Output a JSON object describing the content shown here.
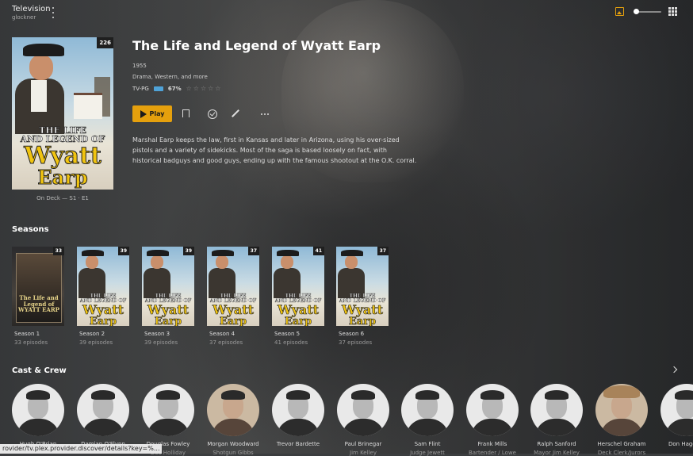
{
  "topbar": {
    "title": "Television",
    "subtitle": "glockner"
  },
  "show": {
    "title": "The Life and Legend of Wyatt Earp",
    "year": "1955",
    "genres": "Drama, Western, and more",
    "content_rating": "TV-PG",
    "audience_score": "67%",
    "summary": "Marshal Earp keeps the law, first in Kansas and later in Arizona, using his over-sized pistols and a variety of sidekicks. Most of the saga is based loosely on fact, with historical badguys and good guys, ending up with the famous shootout at the O.K. corral.",
    "episode_count_badge": "226",
    "on_deck": "On Deck — S1 · E1",
    "poster_text": [
      "THE LIFE",
      "AND LEGEND OF",
      "Wyatt",
      "Earp"
    ]
  },
  "actions": {
    "play_label": "Play"
  },
  "seasons_section": {
    "title": "Seasons"
  },
  "seasons": [
    {
      "name": "Season 1",
      "episodes": "33 episodes",
      "badge": "33",
      "dark": true,
      "poster_text": [
        "The Life and Legend of",
        "WYATT EARP"
      ]
    },
    {
      "name": "Season 2",
      "episodes": "39 episodes",
      "badge": "39",
      "dark": false
    },
    {
      "name": "Season 3",
      "episodes": "39 episodes",
      "badge": "39",
      "dark": false
    },
    {
      "name": "Season 4",
      "episodes": "37 episodes",
      "badge": "37",
      "dark": false
    },
    {
      "name": "Season 5",
      "episodes": "41 episodes",
      "badge": "41",
      "dark": false
    },
    {
      "name": "Season 6",
      "episodes": "37 episodes",
      "badge": "37",
      "dark": false
    }
  ],
  "season_poster_text": [
    "THE LIFE",
    "AND LEGEND OF",
    "Wyatt",
    "Earp"
  ],
  "cast_section": {
    "title": "Cast & Crew"
  },
  "cast": [
    {
      "name": "Hugh O'Brian",
      "role": ""
    },
    {
      "name": "Damian O'Flynn",
      "role": ""
    },
    {
      "name": "Douglas Fowley",
      "role": "Doc Holliday"
    },
    {
      "name": "Morgan Woodward",
      "role": "Shotgun Gibbs"
    },
    {
      "name": "Trevor Bardette",
      "role": ""
    },
    {
      "name": "Paul Brinegar",
      "role": "Jim Kelley"
    },
    {
      "name": "Sam Flint",
      "role": "Judge Jewett"
    },
    {
      "name": "Frank Mills",
      "role": "Bartender / Lowe"
    },
    {
      "name": "Ralph Sanford",
      "role": "Mayor Jim Kelley"
    },
    {
      "name": "Herschel Graham",
      "role": "Deck Clerk/Jurors"
    },
    {
      "name": "Don Hagg",
      "role": ""
    }
  ],
  "statusbar": {
    "url": "rovider/tv.plex.provider.discover/details?key=%..."
  },
  "colors": {
    "accent": "#e5a00d",
    "background": "#3b3d3f"
  }
}
